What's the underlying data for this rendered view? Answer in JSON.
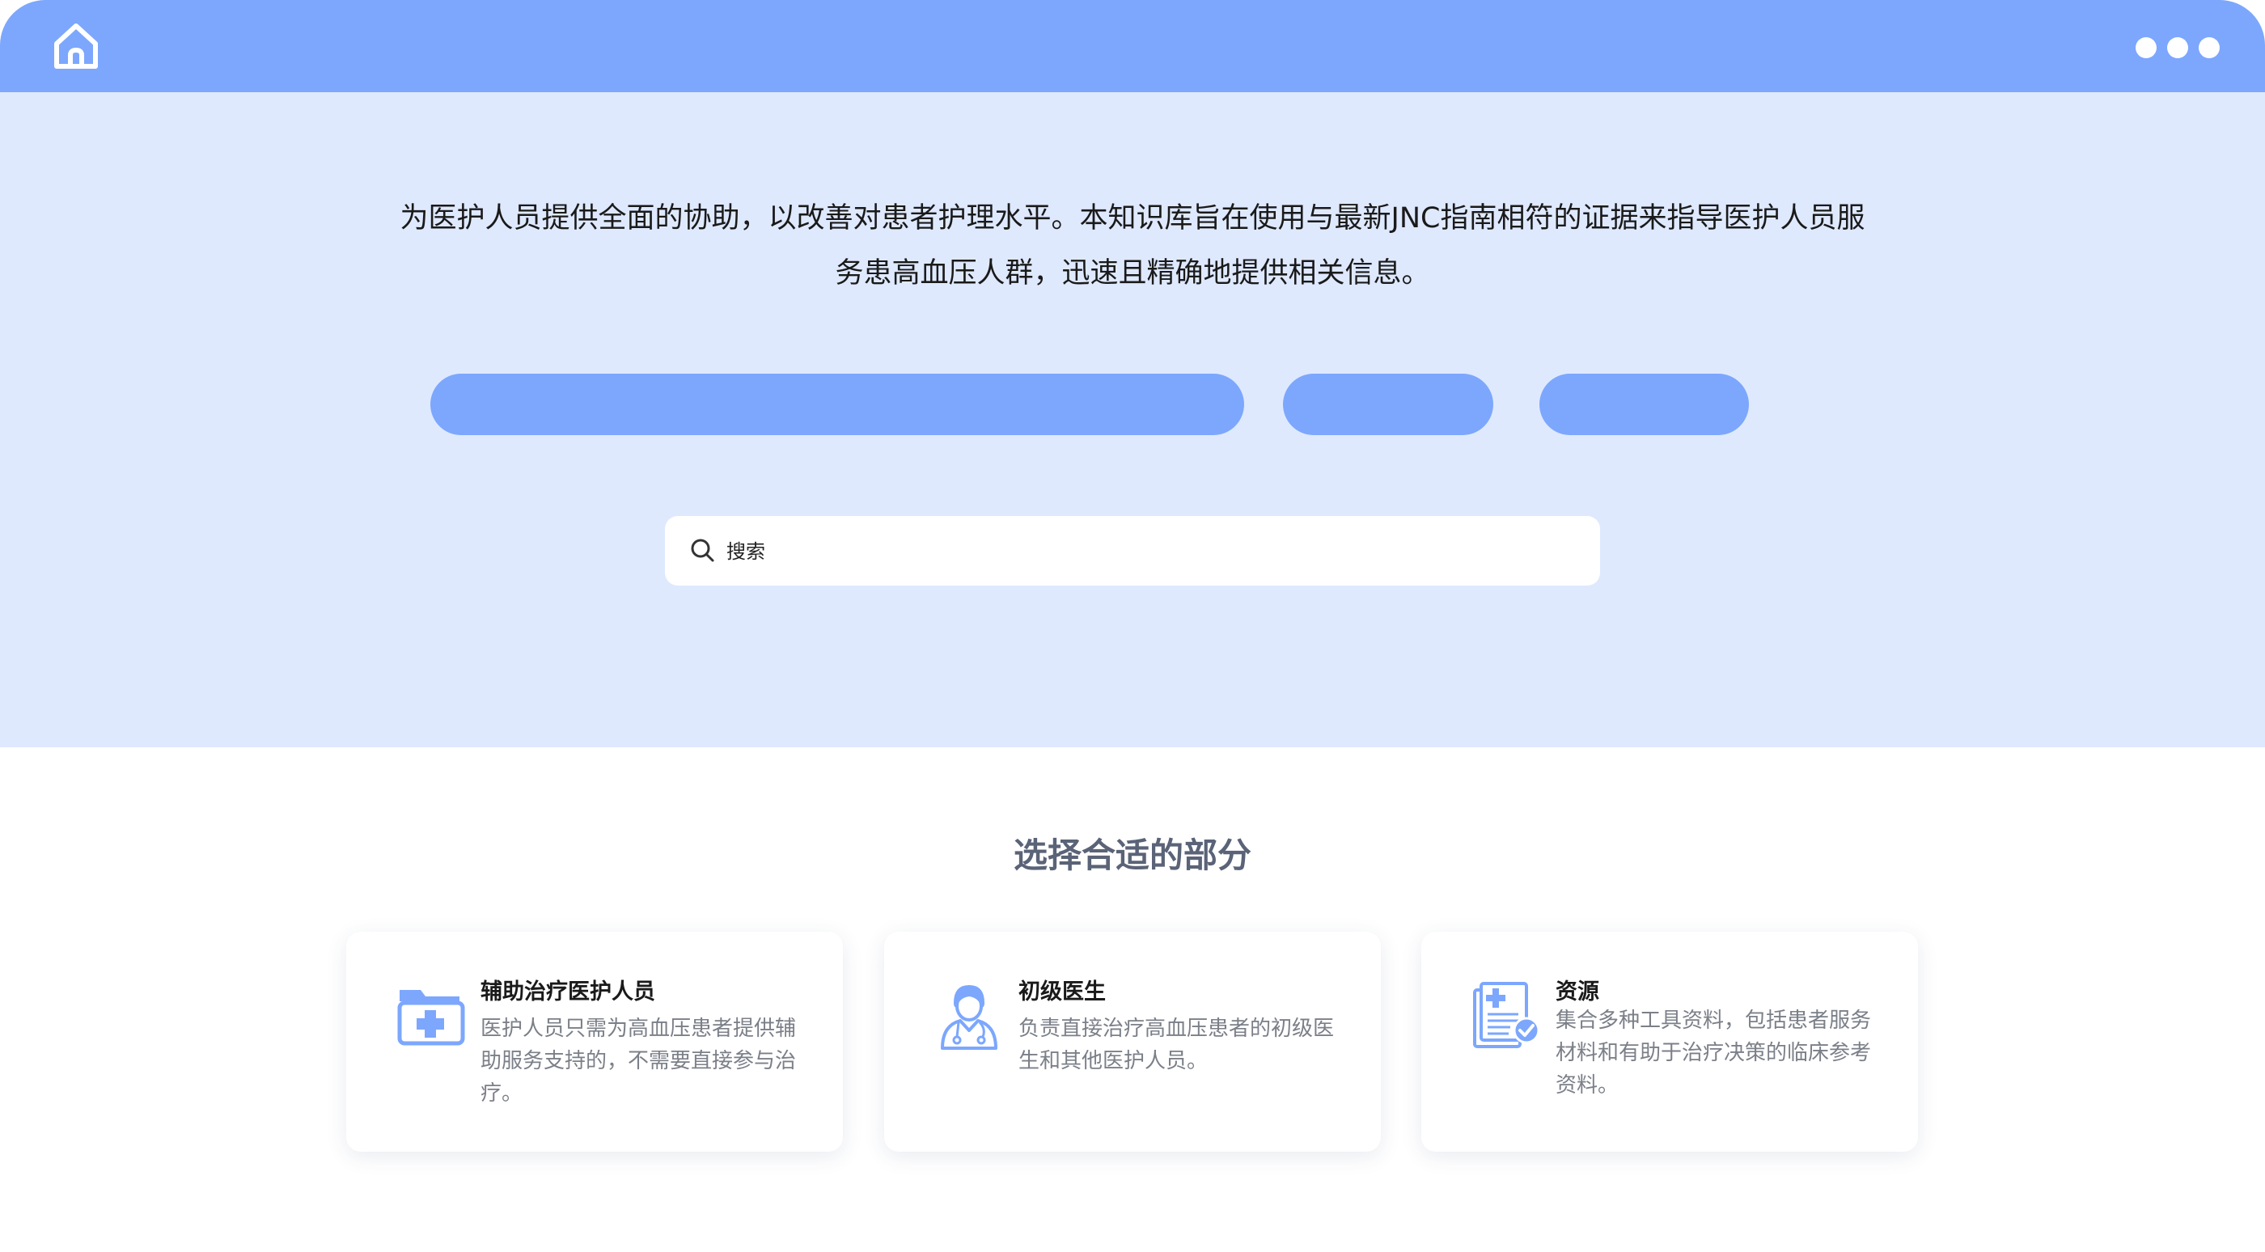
{
  "topbar": {
    "home_icon": "home-icon",
    "menu_icon": "more-dots-icon",
    "accent_color": "#7ca7fd"
  },
  "hero": {
    "intro_line1": "为医护人员提供全面的协助，以改善对患者护理水平。本知识库旨在使用与最新JNC指南相符的证据来指导医护人员服",
    "intro_line2": "务患高血压人群，迅速且精确地提供相关信息。",
    "background_color": "#dfe9fe"
  },
  "search": {
    "placeholder": "搜索",
    "icon": "search-icon"
  },
  "section": {
    "title": "选择合适的部分"
  },
  "cards": [
    {
      "icon": "medical-folder-icon",
      "title": "辅助治疗医护人员",
      "description": "医护人员只需为高血压患者提供辅助服务支持的，不需要直接参与治疗。"
    },
    {
      "icon": "doctor-icon",
      "title": "初级医生",
      "description": "负责直接治疗高血压患者的初级医生和其他医护人员。"
    },
    {
      "icon": "medical-document-icon",
      "title": "资源",
      "description": "集合多种工具资料，包括患者服务材料和有助于治疗决策的临床参考资料。"
    }
  ]
}
